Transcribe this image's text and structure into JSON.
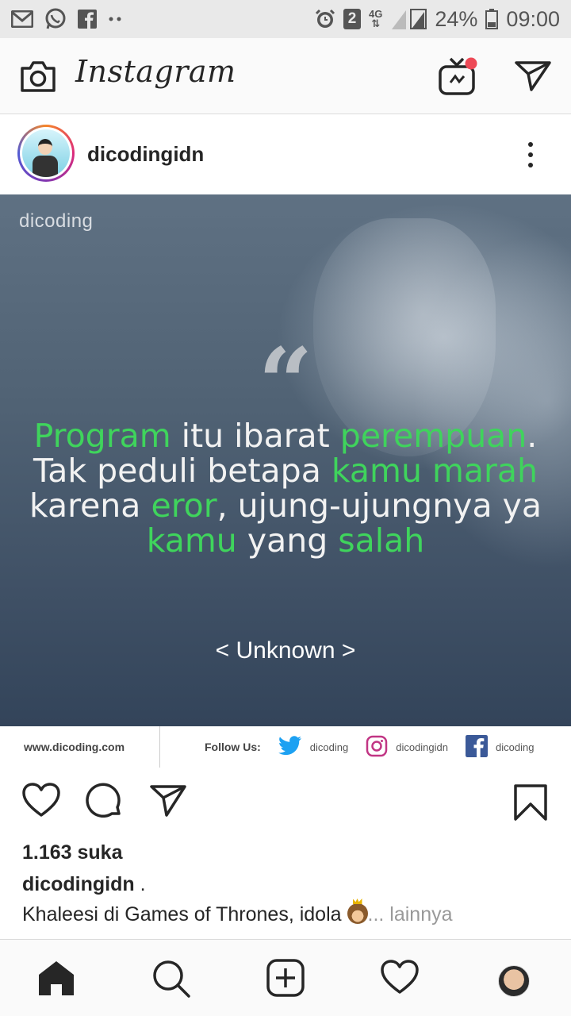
{
  "status_bar": {
    "icons_left": [
      "gmail-icon",
      "whatsapp-icon",
      "facebook-icon",
      "more-notifications-icon"
    ],
    "sim_badge": "2",
    "network": "4G",
    "battery": "24%",
    "time": "09:00"
  },
  "header": {
    "logo": "Instagram",
    "icons": [
      "camera-icon",
      "igtv-icon",
      "direct-send-icon"
    ]
  },
  "post": {
    "username": "dicodingidn",
    "image": {
      "watermark": "dicoding",
      "quote_mark": "“",
      "quote_lines": [
        [
          {
            "t": "Program",
            "hl": true
          },
          {
            "t": " itu ibarat ",
            "hl": false
          },
          {
            "t": "perempuan",
            "hl": true
          },
          {
            "t": ".",
            "hl": false
          }
        ],
        [
          {
            "t": "Tak peduli betapa ",
            "hl": false
          },
          {
            "t": "kamu marah",
            "hl": true
          }
        ],
        [
          {
            "t": "karena ",
            "hl": false
          },
          {
            "t": "eror",
            "hl": true
          },
          {
            "t": ", ujung-ujungnya ya",
            "hl": false
          }
        ],
        [
          {
            "t": "kamu",
            "hl": true
          },
          {
            "t": " yang ",
            "hl": false
          },
          {
            "t": "salah",
            "hl": true
          }
        ]
      ],
      "author": "< Unknown >",
      "footer": {
        "site": "www.dicoding.com",
        "follow_label": "Follow Us:",
        "twitter": "dicoding",
        "instagram": "dicodingidn",
        "facebook": "dicoding"
      }
    },
    "likes": "1.163 suka",
    "caption_user": "dicodingidn",
    "caption_dot": " .",
    "caption_text": "Khaleesi di Games of Thrones, idola ",
    "caption_more": "... lainnya"
  },
  "bottom_nav": [
    "home-icon",
    "search-icon",
    "new-post-icon",
    "activity-icon",
    "profile-avatar"
  ],
  "colors": {
    "highlight_green": "#3fd45c",
    "notification_dot": "#ed4956"
  }
}
